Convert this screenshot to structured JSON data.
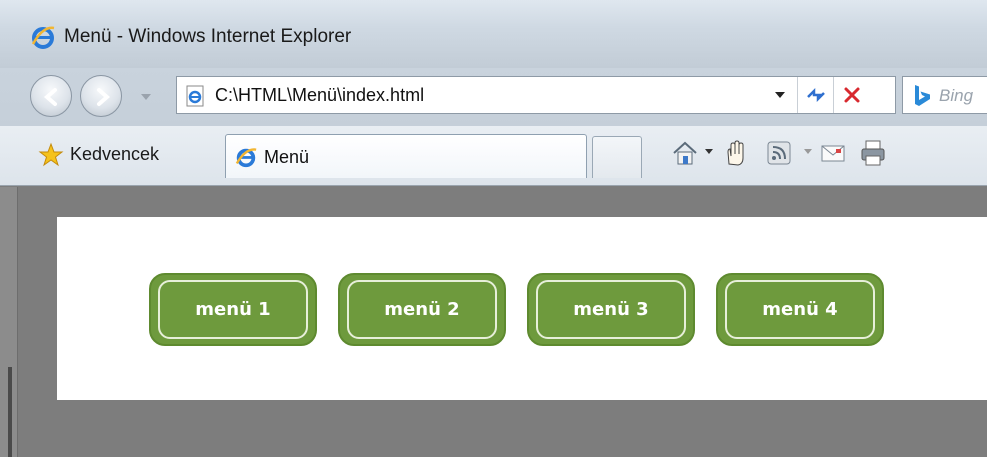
{
  "window": {
    "title": "Menü - Windows Internet Explorer"
  },
  "address_bar": {
    "url": "C:\\HTML\\Menü\\index.html"
  },
  "search": {
    "provider_text": "Bing"
  },
  "favorites": {
    "label": "Kedvencek"
  },
  "tab": {
    "label": "Menü"
  },
  "page": {
    "menu_items": [
      {
        "label": "menü 1"
      },
      {
        "label": "menü 2"
      },
      {
        "label": "menü 3"
      },
      {
        "label": "menü 4"
      }
    ],
    "colors": {
      "button_fill": "#6e9a3d",
      "button_border": "#e7efd9",
      "panel": "#ffffff",
      "background": "#7d7d7d"
    }
  },
  "icons": {
    "window": "ie-logo-icon",
    "back": "back-arrow-icon",
    "forward": "forward-arrow-icon",
    "page": "ie-page-icon",
    "refresh": "refresh-icon",
    "stop": "stop-icon",
    "search": "bing-icon",
    "favorites": "star-icon",
    "home": "home-icon",
    "hand": "hand-icon",
    "feeds": "rss-icon",
    "mail": "mail-icon",
    "print": "print-icon"
  }
}
